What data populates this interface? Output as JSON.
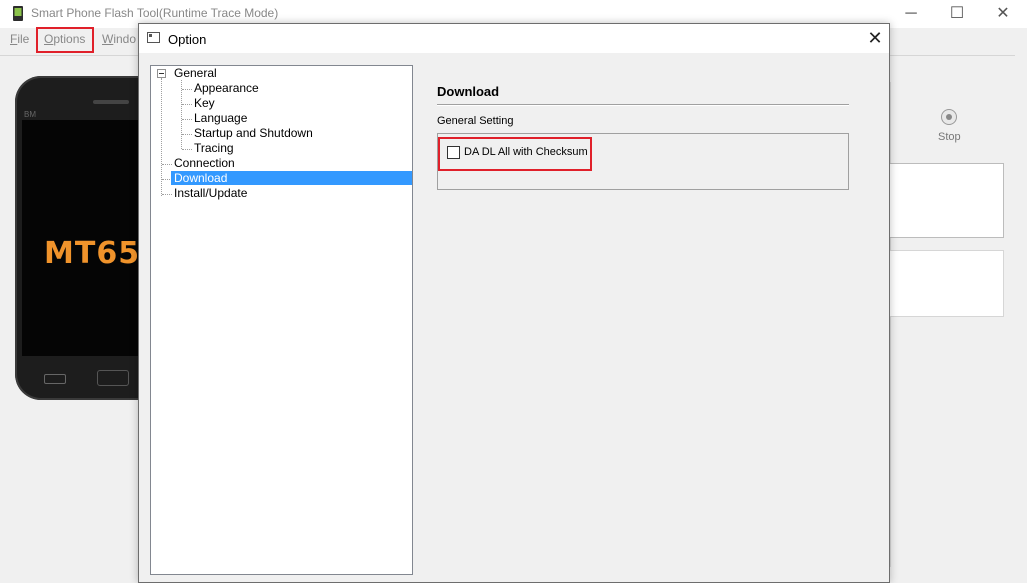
{
  "window": {
    "title": "Smart Phone Flash Tool(Runtime Trace Mode)",
    "minimize_glyph": "─",
    "maximize_glyph": "☐",
    "close_glyph": "✕"
  },
  "menu": {
    "file": "File",
    "options": "Options",
    "window": "Windo"
  },
  "background": {
    "phone_brand": "BM",
    "phone_model": "MT65",
    "stop_label": "Stop"
  },
  "dialog": {
    "title": "Option",
    "close_glyph": "✕",
    "tree": {
      "general": "General",
      "appearance": "Appearance",
      "key": "Key",
      "language": "Language",
      "startup_shutdown": "Startup and Shutdown",
      "tracing": "Tracing",
      "connection": "Connection",
      "download": "Download",
      "install_update": "Install/Update",
      "selected": "Download"
    },
    "section_title": "Download",
    "group_label": "General Setting",
    "checkbox_label": "DA DL All with Checksum",
    "checkbox_checked": false
  },
  "colors": {
    "highlight_red": "#e0202a",
    "selection_blue": "#3399ff",
    "phone_model_orange": "#f0932b"
  }
}
